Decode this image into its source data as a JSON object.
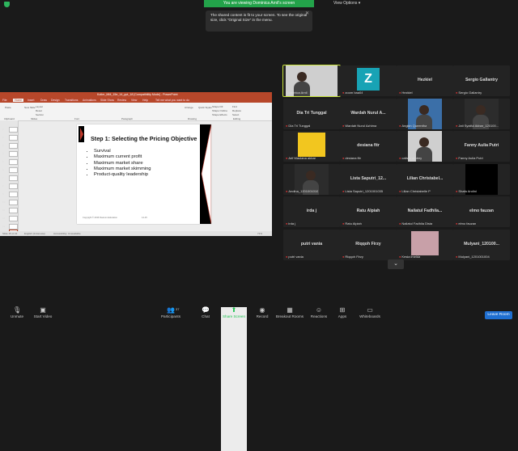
{
  "topbar": {
    "banner": "You are viewing Dominica Arnil's screen",
    "view_options": "View Options ▾"
  },
  "tooltip": {
    "text": "The shared content is fit to your screen. To see the original size, click \"Original Size\" in the menu.",
    "close": "✕"
  },
  "share": {
    "ppt_title": "Kotler_MM_15e_14_ppt_18 [Compatibility Mode] - PowerPoint",
    "tabs": [
      "File",
      "Home",
      "Insert",
      "Draw",
      "Design",
      "Transitions",
      "Animations",
      "Slide Show",
      "Review",
      "View",
      "Help",
      "Tell me what you want to do"
    ],
    "ribbon_groups": [
      "Clipboard",
      "Slides",
      "Font",
      "Paragraph",
      "Drawing",
      "Editing"
    ],
    "ribbon_items": [
      "Paste",
      "New Slide",
      "Layout",
      "Reset",
      "Section",
      "Arrange",
      "Quick Styles",
      "Shape Fill",
      "Shape Outline",
      "Shape Effects",
      "Find",
      "Replace",
      "Select"
    ],
    "thumb_numbers": [
      "1",
      "2",
      "3",
      "4",
      "5",
      "6",
      "7",
      "8",
      "9",
      "10",
      "11",
      "12",
      "13",
      "14"
    ],
    "slide": {
      "title": "Step 1: Selecting the Pricing Objective",
      "bullets": [
        "Survival",
        "Maximum current profit",
        "Maximum market share",
        "Maximum market skimming",
        "Product-quality leadership"
      ],
      "footer_left": "Copyright © 2016 Pearson Education",
      "footer_page": "14-15"
    },
    "status": {
      "slide_no": "Slide 15 of 23",
      "language": "English (Indonesia)",
      "accessibility": "Accessibility: Unavailable",
      "zoom": "71%"
    }
  },
  "participants": [
    {
      "name": "",
      "label": "Dominica Arnil",
      "mic": "",
      "kind": "video"
    },
    {
      "name": "Z",
      "label": "zoom baa04",
      "mic": "●",
      "kind": "z"
    },
    {
      "name": "Hezkiel",
      "label": "Hezkiel",
      "mic": "●",
      "kind": "name"
    },
    {
      "name": "Sergio Gallantry",
      "label": "Sergio Gallantry",
      "mic": "●",
      "kind": "name"
    },
    {
      "name": "Dia Tri Tunggal",
      "label": "Dia Tri Tunggal",
      "mic": "●",
      "kind": "name"
    },
    {
      "name": "Wardah Nurul A...",
      "label": "Wardah Nurul Azhima",
      "mic": "●",
      "kind": "name"
    },
    {
      "name": "",
      "label": "Angkin Queentha",
      "mic": "●",
      "kind": "video"
    },
    {
      "name": "",
      "label": "Jati Syaiful Akbar_120100...",
      "mic": "●",
      "kind": "video"
    },
    {
      "name": "",
      "label": "Arif Maulana akbar",
      "mic": "●",
      "kind": "yellow"
    },
    {
      "name": "desiana fitr",
      "label": "desiana fitr",
      "mic": "●",
      "kind": "name"
    },
    {
      "name": "",
      "label": "calista audrey",
      "mic": "●",
      "kind": "video"
    },
    {
      "name": "Fanny Aulia Putri",
      "label": "Fanny Aulia Putri",
      "mic": "●",
      "kind": "name"
    },
    {
      "name": "",
      "label": "Andina_1201001010",
      "mic": "●",
      "kind": "video"
    },
    {
      "name": "Lista Saputri_12...",
      "label": "Lista Saputri_1201001035",
      "mic": "●",
      "kind": "name"
    },
    {
      "name": "Lilian Christabel...",
      "label": "Lilian Christabelle P",
      "mic": "●",
      "kind": "name"
    },
    {
      "name": "",
      "label": "Shafa Andini",
      "mic": "●",
      "kind": "black"
    },
    {
      "name": "irda j",
      "label": "irda j",
      "mic": "●",
      "kind": "name"
    },
    {
      "name": "Ratu Alpiah",
      "label": "Ratu Alpiah",
      "mic": "●",
      "kind": "name"
    },
    {
      "name": "Nailatul Fadhila...",
      "label": "Nailatul Fadhila Dista",
      "mic": "●",
      "kind": "name"
    },
    {
      "name": "elmo fauzan",
      "label": "elmo fauzan",
      "mic": "●",
      "kind": "name"
    },
    {
      "name": "putri vania",
      "label": "putri vania",
      "mic": "●",
      "kind": "name"
    },
    {
      "name": "Riqqoh Firzy",
      "label": "Riqqoh Firzy",
      "mic": "●",
      "kind": "name"
    },
    {
      "name": "",
      "label": "Kesia imelda",
      "mic": "●",
      "kind": "pink"
    },
    {
      "name": "Mulyani_120100...",
      "label": "Mulyani_1201001004",
      "mic": "●",
      "kind": "name"
    }
  ],
  "toolbar": {
    "unmute": "Unmute",
    "start_video": "Start Video",
    "participants": "Participants",
    "participants_count": "37",
    "chat": "Chat",
    "share_screen": "Share Screen",
    "record": "Record",
    "breakout": "Breakout Rooms",
    "reactions": "Reactions",
    "apps": "Apps",
    "whiteboards": "Whiteboards",
    "leave": "Leave Room"
  },
  "colors": {
    "accent_green": "#23a34a",
    "leave_blue": "#1f6fd1",
    "ppt_red": "#b7472a",
    "active_speaker": "#c8e23a"
  }
}
